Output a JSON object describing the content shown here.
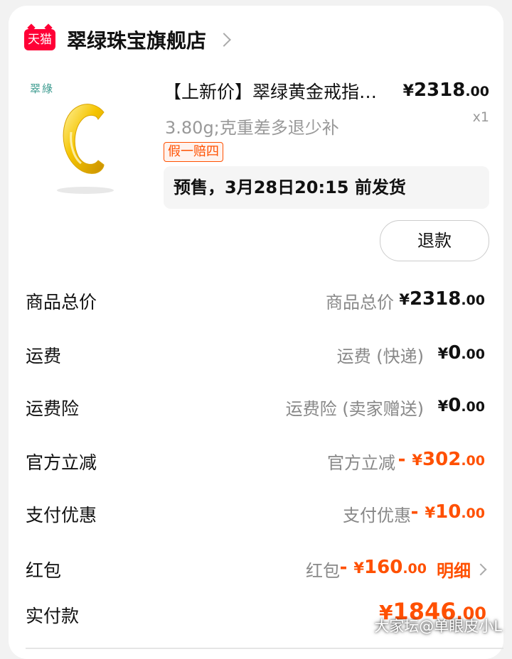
{
  "shop": {
    "badge": "天猫",
    "name": "翠绿珠宝旗舰店"
  },
  "product": {
    "thumb_brand": "翠綠",
    "title": "【上新价】翠绿黄金戒指…",
    "price_currency": "¥",
    "price_int": "2318",
    "price_dec": ".00",
    "quantity": "x1",
    "sku": "3.80g;克重差多退少补",
    "badge": "假一赔四",
    "presale": "预售，3月28日20:15 前发货",
    "refund_button": "退款"
  },
  "fees": [
    {
      "label": "商品总价",
      "desc": "商品总价",
      "sign": "",
      "currency": "¥",
      "int": "2318",
      "dec": ".00"
    },
    {
      "label": "运费",
      "desc": "运费 (快递)",
      "sign": "",
      "currency": "¥",
      "int": "0",
      "dec": ".00"
    },
    {
      "label": "运费险",
      "desc": "运费险 (卖家赠送)",
      "sign": "",
      "currency": "¥",
      "int": "0",
      "dec": ".00"
    },
    {
      "label": "官方立减",
      "desc": "官方立减",
      "sign": "-",
      "currency": "¥",
      "int": "302",
      "dec": ".00"
    },
    {
      "label": "支付优惠",
      "desc": "支付优惠",
      "sign": "-",
      "currency": "¥",
      "int": "10",
      "dec": ".00"
    },
    {
      "label": "红包",
      "desc": "红包",
      "sign": "-",
      "currency": "¥",
      "int": "160",
      "dec": ".00",
      "detail": "明细"
    }
  ],
  "paid": {
    "label": "实付款",
    "currency": "¥",
    "int": "1846",
    "dec": ".00"
  },
  "watermark": "大家坛@单眼皮小L",
  "colors": {
    "accent": "#ff5000",
    "tmall": "#ff0036",
    "muted": "#888888"
  }
}
